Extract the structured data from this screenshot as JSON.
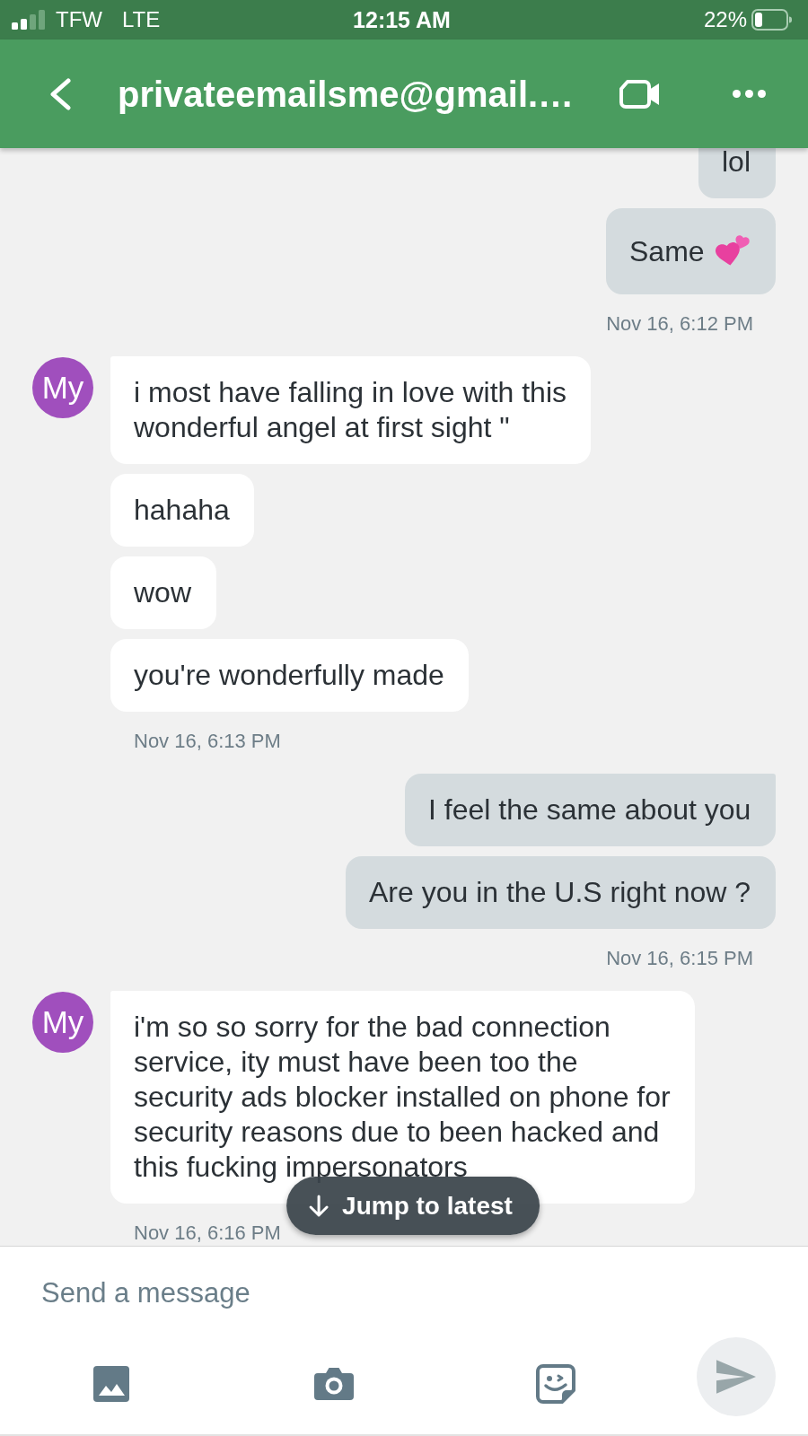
{
  "status_bar": {
    "carrier": "TFW",
    "network": "LTE",
    "time": "12:15 AM",
    "battery": "22%"
  },
  "header": {
    "title": "privateemailsme@gmail.…"
  },
  "conversation": [
    {
      "kind": "outgoing",
      "messages": [
        {
          "text": "lol"
        },
        {
          "text": "Same",
          "emoji": true
        }
      ],
      "time": "Nov 16, 6:12 PM"
    },
    {
      "kind": "incoming",
      "avatar": "My",
      "messages": [
        {
          "text": "i most have falling in love with this wonderful angel at first sight \""
        },
        {
          "text": "hahaha"
        },
        {
          "text": "wow"
        },
        {
          "text": "you're wonderfully made"
        }
      ],
      "time": "Nov 16, 6:13 PM"
    },
    {
      "kind": "outgoing",
      "messages": [
        {
          "text": "I feel the same about you"
        },
        {
          "text": "Are you in the U.S right now ?"
        }
      ],
      "time": "Nov 16, 6:15 PM"
    },
    {
      "kind": "incoming",
      "avatar": "My",
      "messages": [
        {
          "text": "i'm so so sorry for the bad connection service, ity must have been too the security ads blocker installed on phone for security reasons due to been hacked and this fucking impersonators"
        }
      ],
      "time": "Nov 16, 6:16 PM"
    }
  ],
  "jump_button": {
    "label": "Jump to latest"
  },
  "composer": {
    "placeholder": "Send a message",
    "send_disabled": true
  }
}
